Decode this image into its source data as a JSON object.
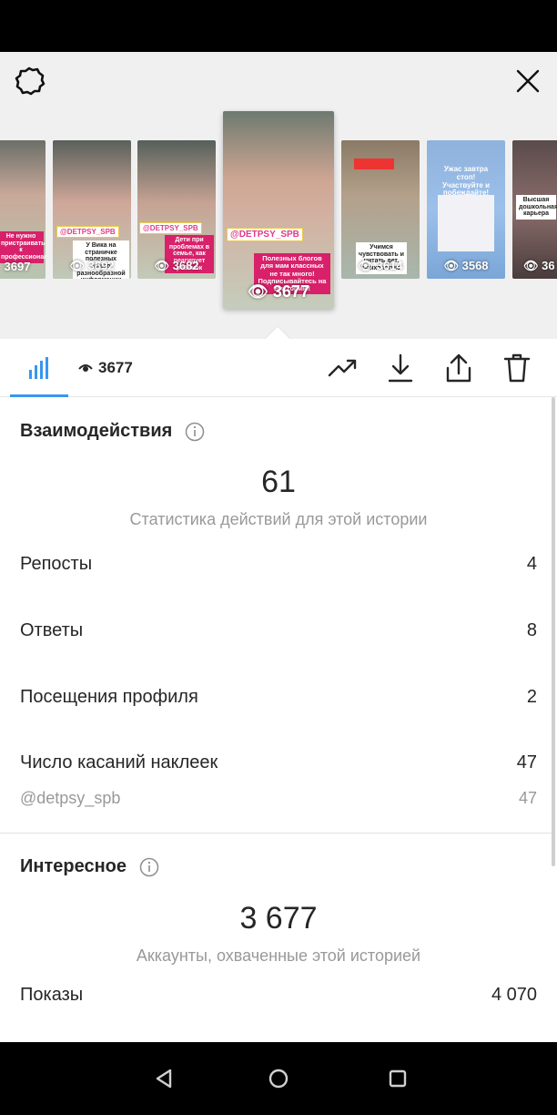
{
  "stories": [
    {
      "views": "3697",
      "sticker": "",
      "caption": "Не нужно пристраиваться к профессионалу!"
    },
    {
      "views": "3692",
      "sticker": "@DETPSY_SPB",
      "caption": "У Вика на страничке полезных много разнообразной информации"
    },
    {
      "views": "3682",
      "sticker": "@DETPSY_SPB",
      "caption": "Дети при проблемах в семье, как реагирует ребенок"
    },
    {
      "views": "3677",
      "sticker": "@DETPSY_SPB",
      "caption": "Полезных блогов для мам классных не так много! Подписывайтесь на Викторию!"
    },
    {
      "views": "3614",
      "sticker": "",
      "caption": "Учимся чувствовать и читать дет. психологию"
    },
    {
      "views": "3568",
      "sticker": "",
      "caption": "Ужас завтра стоп! Участвуйте и побеждайте!"
    },
    {
      "views": "36",
      "sticker": "",
      "caption": "Высшая дошкольная карьера"
    }
  ],
  "toolbar": {
    "view_count": "3677"
  },
  "interactions": {
    "title": "Взаимодействия",
    "total": "61",
    "total_caption": "Статистика действий для этой истории",
    "rows": [
      {
        "label": "Репосты",
        "value": "4"
      },
      {
        "label": "Ответы",
        "value": "8"
      },
      {
        "label": "Посещения профиля",
        "value": "2"
      },
      {
        "label": "Число касаний наклеек",
        "value": "47"
      }
    ],
    "sub_row": {
      "label": "@detpsy_spb",
      "value": "47"
    }
  },
  "discovery": {
    "title": "Интересное",
    "total": "3 677",
    "total_caption": "Аккаунты, охваченные этой историей",
    "rows": [
      {
        "label": "Показы",
        "value": "4 070"
      }
    ]
  },
  "colors": {
    "accent": "#3897f0",
    "text": "#262626",
    "muted": "#999999"
  }
}
